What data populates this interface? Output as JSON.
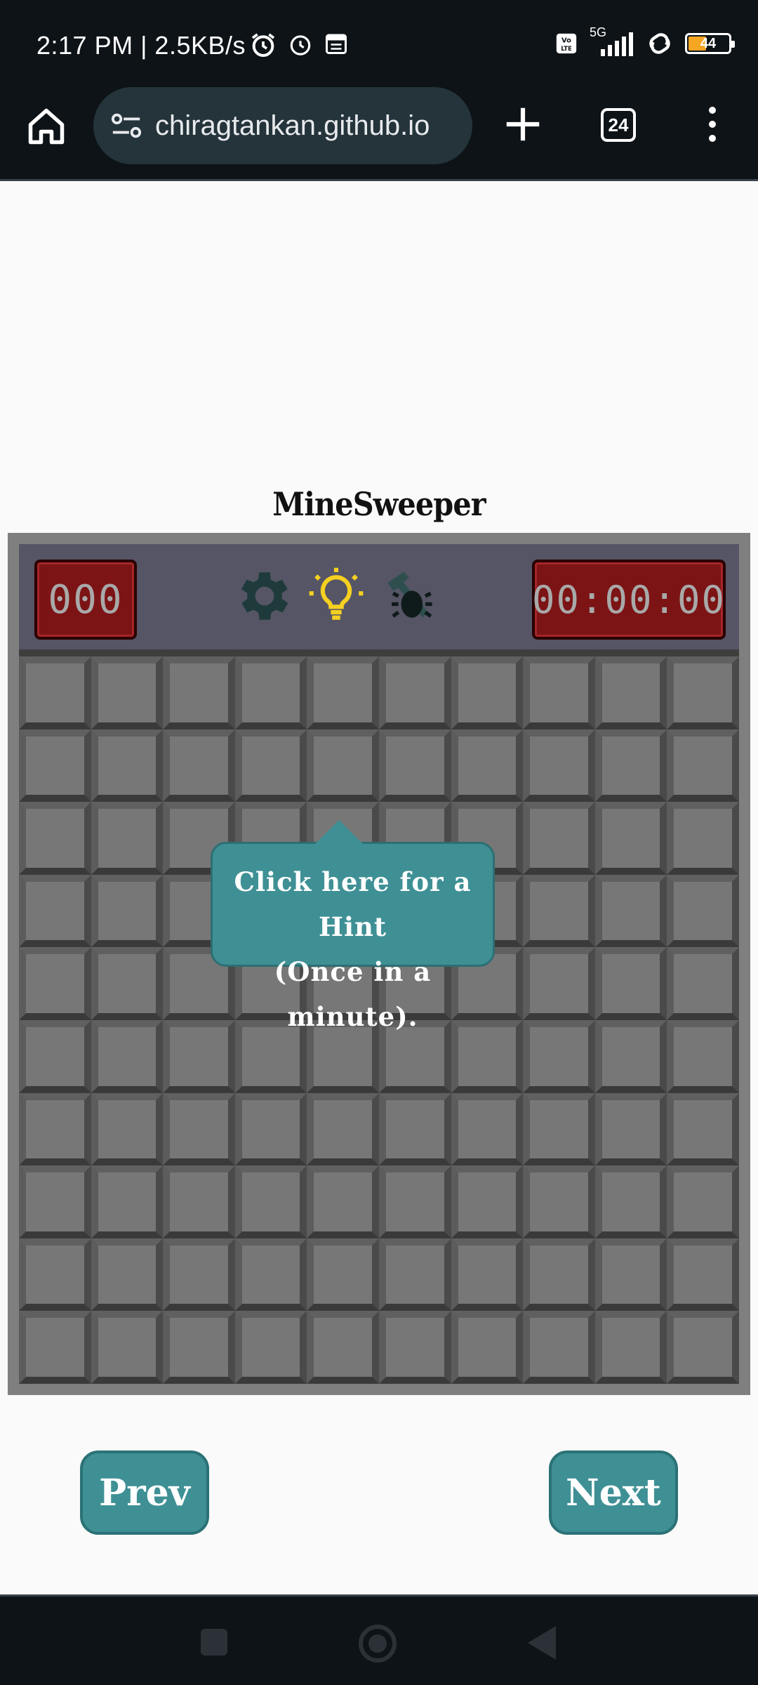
{
  "status_bar": {
    "time": "2:17 PM | 2.5KB/s",
    "network": "5G",
    "volte": "Vo LTE",
    "battery": "44"
  },
  "browser": {
    "url": "chiragtankan.github.io",
    "tab_count": "24"
  },
  "game": {
    "title": "MineSweeper",
    "mine_counter": "000",
    "timer": "00:00:00",
    "grid_rows": 10,
    "grid_cols": 10,
    "tooltip_line1": "Click here for a Hint",
    "tooltip_line2": "(Once in a minute).",
    "prev_label": "Prev",
    "next_label": "Next"
  },
  "colors": {
    "accent_teal": "#3f9095",
    "counter_red": "#7c1416",
    "hint_yellow": "#f5d020"
  }
}
